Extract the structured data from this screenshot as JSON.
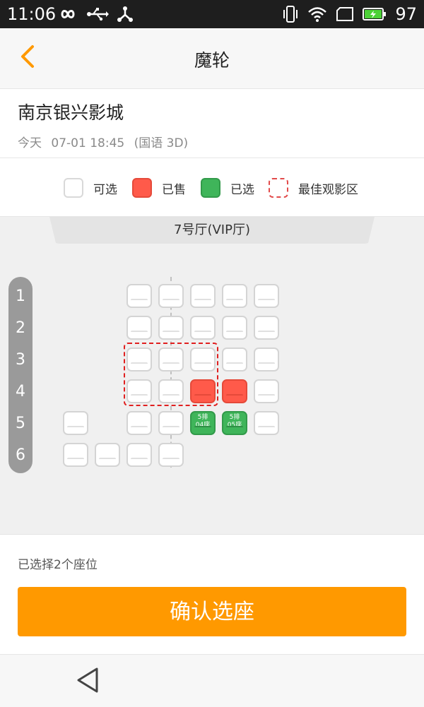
{
  "status_bar": {
    "time": "11:06",
    "battery_level": "97",
    "icons_left": [
      "infinity-icon",
      "usb-icon",
      "share-icon"
    ],
    "icons_right": [
      "vibrate-icon",
      "wifi-icon",
      "signal-icon",
      "battery-icon"
    ]
  },
  "header": {
    "title": "魔轮"
  },
  "cinema": {
    "name": "南京银兴影城",
    "day": "今天",
    "datetime": "07-01 18:45",
    "format": "(国语 3D)"
  },
  "legend": {
    "available": "可选",
    "sold": "已售",
    "selected": "已选",
    "best_zone": "最佳观影区"
  },
  "hall": {
    "name": "7号厅(VIP厅)"
  },
  "rows": [
    "1",
    "2",
    "3",
    "4",
    "5",
    "6"
  ],
  "seats": [
    {
      "row": 1,
      "col": 3,
      "status": "available"
    },
    {
      "row": 1,
      "col": 4,
      "status": "available"
    },
    {
      "row": 1,
      "col": 5,
      "status": "available"
    },
    {
      "row": 1,
      "col": 6,
      "status": "available"
    },
    {
      "row": 1,
      "col": 7,
      "status": "available"
    },
    {
      "row": 2,
      "col": 3,
      "status": "available"
    },
    {
      "row": 2,
      "col": 4,
      "status": "available"
    },
    {
      "row": 2,
      "col": 5,
      "status": "available"
    },
    {
      "row": 2,
      "col": 6,
      "status": "available"
    },
    {
      "row": 2,
      "col": 7,
      "status": "available"
    },
    {
      "row": 3,
      "col": 3,
      "status": "available"
    },
    {
      "row": 3,
      "col": 4,
      "status": "available"
    },
    {
      "row": 3,
      "col": 5,
      "status": "available"
    },
    {
      "row": 3,
      "col": 6,
      "status": "available"
    },
    {
      "row": 3,
      "col": 7,
      "status": "available"
    },
    {
      "row": 4,
      "col": 3,
      "status": "available"
    },
    {
      "row": 4,
      "col": 4,
      "status": "available"
    },
    {
      "row": 4,
      "col": 5,
      "status": "sold"
    },
    {
      "row": 4,
      "col": 6,
      "status": "sold"
    },
    {
      "row": 4,
      "col": 7,
      "status": "available"
    },
    {
      "row": 5,
      "col": 1,
      "status": "available"
    },
    {
      "row": 5,
      "col": 3,
      "status": "available"
    },
    {
      "row": 5,
      "col": 4,
      "status": "available"
    },
    {
      "row": 5,
      "col": 5,
      "status": "selected",
      "label_row": "5排",
      "label_seat": "04座"
    },
    {
      "row": 5,
      "col": 6,
      "status": "selected",
      "label_row": "5排",
      "label_seat": "05座"
    },
    {
      "row": 5,
      "col": 7,
      "status": "available"
    },
    {
      "row": 6,
      "col": 1,
      "status": "available"
    },
    {
      "row": 6,
      "col": 2,
      "status": "available"
    },
    {
      "row": 6,
      "col": 3,
      "status": "available"
    },
    {
      "row": 6,
      "col": 4,
      "status": "available"
    }
  ],
  "footer": {
    "selected_text": "已选择2个座位",
    "confirm_label": "确认选座"
  },
  "colors": {
    "accent": "#ff9900",
    "sold": "#ff5a4a",
    "selected": "#3fb55a",
    "best_zone_border": "#e02020"
  }
}
